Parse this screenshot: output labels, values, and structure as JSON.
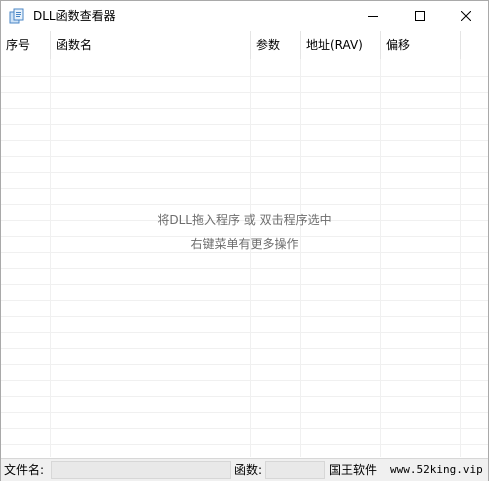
{
  "window": {
    "title": "DLL函数查看器",
    "icon": "app-dll-icon"
  },
  "columns": [
    {
      "label": "序号"
    },
    {
      "label": "函数名"
    },
    {
      "label": "参数"
    },
    {
      "label": "地址(RAV)"
    },
    {
      "label": "偏移"
    }
  ],
  "empty_state": {
    "line1": "将DLL拖入程序 或 双击程序选中",
    "line2": "右键菜单有更多操作"
  },
  "statusbar": {
    "filename_label": "文件名:",
    "filename_value": "",
    "functions_label": "函数:",
    "functions_value": "",
    "author": "国王软件",
    "website": "www.52king.vip"
  },
  "colors": {
    "border": "#a9a9a9",
    "gridline": "#f0f0f0",
    "statusbar_bg": "#f0f0f0",
    "empty_text": "#6d6d6d"
  }
}
